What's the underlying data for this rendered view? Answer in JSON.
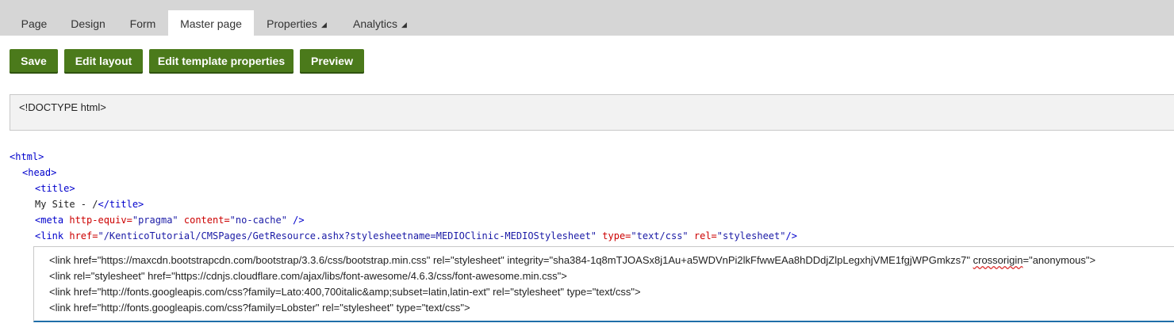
{
  "tabs": [
    {
      "label": "Page",
      "active": false,
      "has_menu": false
    },
    {
      "label": "Design",
      "active": false,
      "has_menu": false
    },
    {
      "label": "Form",
      "active": false,
      "has_menu": false
    },
    {
      "label": "Master page",
      "active": true,
      "has_menu": false
    },
    {
      "label": "Properties",
      "active": false,
      "has_menu": true
    },
    {
      "label": "Analytics",
      "active": false,
      "has_menu": true
    }
  ],
  "caret_glyph": "◢",
  "toolbar": {
    "save": "Save",
    "edit_layout": "Edit layout",
    "edit_template_properties": "Edit template properties",
    "preview": "Preview"
  },
  "doctype": "<!DOCTYPE html>",
  "code": {
    "html_open": "<html>",
    "head_open": "<head>",
    "title_open": "<title>",
    "title_text": "My Site - /",
    "title_close": "</title>",
    "meta_open": "<meta",
    "meta_attr1": "http-equiv=",
    "meta_val1": "\"pragma\"",
    "meta_attr2": "content=",
    "meta_val2": "\"no-cache\"",
    "meta_end": "/>",
    "link_open": "<link",
    "link_attr1": "href=",
    "link_val1": "\"/KenticoTutorial/CMSPages/GetResource.ashx?stylesheetname=MEDIOClinic-MEDIOStylesheet\"",
    "link_attr2": "type=",
    "link_val2": "\"text/css\"",
    "link_attr3": "rel=",
    "link_val3": "\"stylesheet\"",
    "link_end": "/>"
  },
  "editor_lines": {
    "line1_pre": "<link href=\"https://maxcdn.bootstrapcdn.com/bootstrap/3.3.6/css/bootstrap.min.css\" rel=\"stylesheet\" integrity=\"sha384-1q8mTJOASx8j1Au+a5WDVnPi2lkFfwwEAa8hDDdjZlpLegxhjVME1fgjWPGmkzs7\" ",
    "line1_squiggle": "crossorigin",
    "line1_post": "=\"anonymous\">",
    "line2": "<link rel=\"stylesheet\" href=\"https://cdnjs.cloudflare.com/ajax/libs/font-awesome/4.6.3/css/font-awesome.min.css\">",
    "line3": "<link href=\"http://fonts.googleapis.com/css?family=Lato:400,700italic&amp;subset=latin,latin-ext\" rel=\"stylesheet\" type=\"text/css\">",
    "line4": "<link href=\"http://fonts.googleapis.com/css?family=Lobster\" rel=\"stylesheet\" type=\"text/css\">"
  },
  "colors": {
    "button": "#4b7a1b",
    "tag": "#0000cc",
    "attribute": "#cc0000",
    "value": "#1a1aa6"
  }
}
